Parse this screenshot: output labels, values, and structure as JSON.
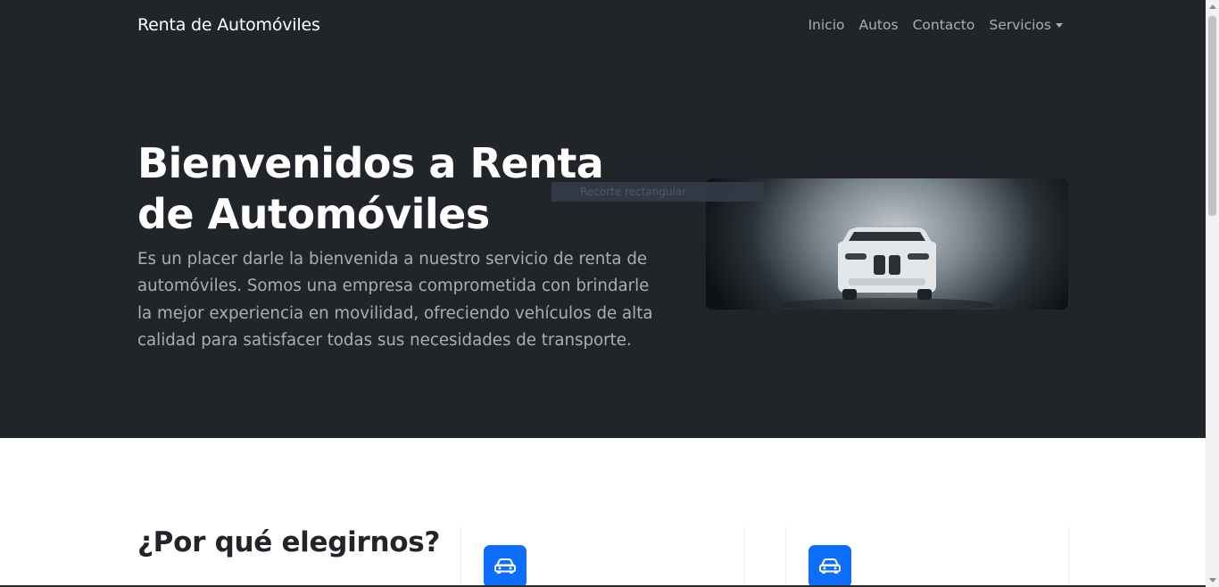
{
  "navbar": {
    "brand": "Renta de Automóviles",
    "links": [
      "Inicio",
      "Autos",
      "Contacto",
      "Servicios"
    ]
  },
  "hero": {
    "title": "Bienvenidos a Renta de Automóviles",
    "text": "Es un placer darle la bienvenida a nuestro servicio de renta de automóviles. Somos una empresa comprometida con brindarle la mejor experiencia en movilidad, ofreciendo vehículos de alta calidad para satisfacer todas sus necesidades de transporte.",
    "image_icon": "car-photo"
  },
  "overlay": {
    "snip_label": "Recorte rectangular"
  },
  "features": {
    "title": "¿Por qué elegirnos?",
    "icons": [
      "car-front-icon",
      "car-front-icon"
    ]
  },
  "colors": {
    "dark_bg": "#212529",
    "primary": "#0d6efd"
  }
}
